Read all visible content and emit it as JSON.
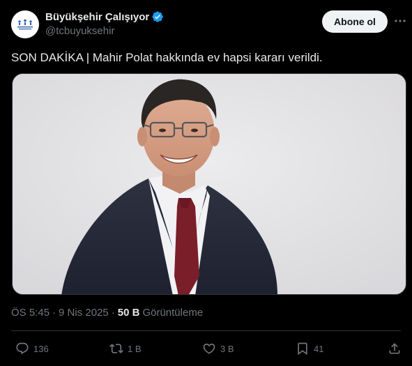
{
  "account": {
    "display_name": "Büyükşehir Çalışıyor",
    "handle": "@tcbuyuksehir",
    "avatar_icon": "buyuksehir-logo",
    "verified": true
  },
  "follow_button_label": "Abone ol",
  "more_icon": "more-horizontal-icon",
  "tweet": {
    "text": "SON DAKİKA | Mahir Polat hakkında ev hapsi kararı verildi.",
    "time": "ÖS 5:45",
    "separator": "·",
    "date": "9 Nis 2025",
    "views_count": "50 B",
    "views_label": "Görüntüleme"
  },
  "actions": {
    "replies": "136",
    "reposts": "1 B",
    "likes": "3 B",
    "bookmarks": "41"
  },
  "colors": {
    "background": "#000000",
    "text_primary": "#e7e9ea",
    "text_secondary": "#71767b",
    "verified_blue": "#1d9bf0",
    "divider": "#2f3336"
  }
}
